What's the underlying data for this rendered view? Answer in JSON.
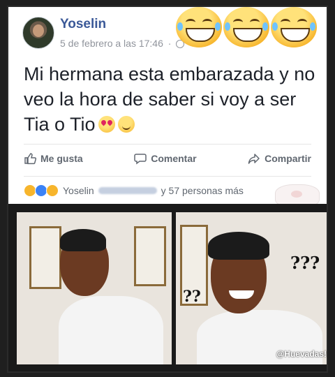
{
  "post": {
    "author": "Yoselin",
    "timestamp": "5 de febrero a las 17:46",
    "text": "Mi hermana esta embarazada y no veo la hora de saber si voy a ser Tia o Tio",
    "actions": {
      "like": "Me gusta",
      "comment": "Comentar",
      "share": "Compartir"
    },
    "reactions": {
      "first_name": "Yoselin",
      "others": "y 57 personas más"
    }
  },
  "meme": {
    "left_marks": "??",
    "right_marks": "???",
    "watermark": "@Huevadas!"
  },
  "colors": {
    "link_blue": "#3b5998",
    "text": "#1d2129",
    "muted": "#90949c",
    "action_gray": "#606770"
  },
  "icons": [
    "globe-icon",
    "laughing-emoji-icon",
    "heart-eyes-emoji-icon",
    "smiling-emoji-icon",
    "thumbs-up-icon",
    "comment-icon",
    "share-icon",
    "haha-reaction-icon",
    "like-reaction-icon",
    "wow-reaction-icon"
  ]
}
